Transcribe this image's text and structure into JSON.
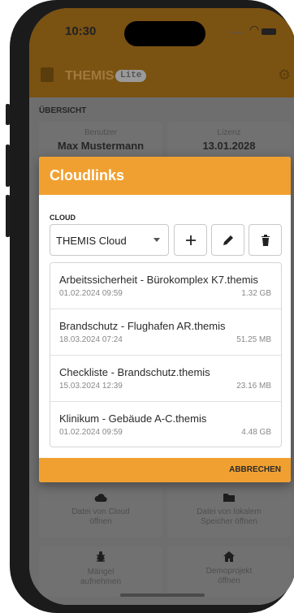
{
  "status_bar": {
    "time": "10:30"
  },
  "app_bar": {
    "title": "THEMIS",
    "badge": "Lite"
  },
  "overview": {
    "section_label": "ÜBERSICHT",
    "user": {
      "label": "Benutzer",
      "value": "Max Mustermann"
    },
    "license": {
      "label": "Lizenz",
      "value": "13.01.2028"
    }
  },
  "actions": [
    {
      "icon": "cloud-icon",
      "label": "Datei von Cloud\nöffnen"
    },
    {
      "icon": "folder-icon",
      "label": "Datei von lokalem\nSpeicher öffnen"
    },
    {
      "icon": "bug-icon",
      "label": "Mängel\naufnehmen"
    },
    {
      "icon": "home-icon",
      "label": "Demoprojekt\nöffnen"
    }
  ],
  "dialog": {
    "title": "Cloudlinks",
    "cloud_label": "CLOUD",
    "selected_cloud": "THEMIS Cloud",
    "cancel_label": "ABBRECHEN",
    "files": [
      {
        "name": "Arbeitssicherheit - Bürokomplex K7.themis",
        "date": "01.02.2024 09:59",
        "size": "1.32 GB"
      },
      {
        "name": "Brandschutz - Flughafen AR.themis",
        "date": "18.03.2024 07:24",
        "size": "51.25 MB"
      },
      {
        "name": "Checkliste - Brandschutz.themis",
        "date": "15.03.2024 12:39",
        "size": "23.16 MB"
      },
      {
        "name": "Klinikum - Gebäude A-C.themis",
        "date": "01.02.2024 09:59",
        "size": "4.48 GB"
      }
    ]
  },
  "colors": {
    "accent": "#f0a031",
    "scrim_bg": "#6e6e6e"
  }
}
